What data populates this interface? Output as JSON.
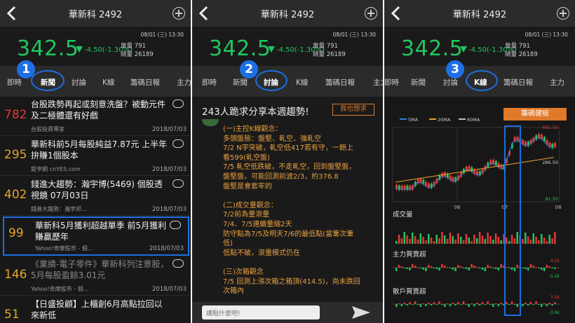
{
  "header": {
    "title": "華新科 2492"
  },
  "quote": {
    "time": "08/01 (三) 13:30",
    "price": "342.5",
    "change": "-4.50(-1.30%)",
    "single": "單量 791",
    "total": "總量 26189"
  },
  "tabs": [
    "即時",
    "新聞",
    "討論",
    "K線",
    "籌碼日報",
    "主力"
  ],
  "badges": [
    "1",
    "2",
    "3"
  ],
  "news": [
    {
      "num": "782",
      "color": "#e53935",
      "title": "台股跌勢再起或刻意洗盤？被動元件及二極體還有好戲",
      "source": "台股投資專家",
      "date": "2018/07/03",
      "dim": false
    },
    {
      "num": "295",
      "color": "#e6a52a",
      "title": "華新科前5月每股純益7.87元 上半年拚賺1個股本",
      "source": "鉅亨網 cnYES.com",
      "date": "2018/07/03",
      "dim": false
    },
    {
      "num": "402",
      "color": "#e6a52a",
      "title": "錢進大趨勢：瀚宇博(5469) 個股透視鏡 07月03日",
      "source": "錢進大趨勢：瀚宇邦...",
      "date": "2018/07/03",
      "dim": false
    },
    {
      "num": "99",
      "color": "#e6a52a",
      "title": "華新科5月獲利超越單季 前5月獲利賺贏歷年",
      "source": "Yahoo!奇摩股市 - 個...",
      "date": "2018/07/03",
      "dim": false
    },
    {
      "num": "146",
      "color": "#e6a52a",
      "title": "《業績-電子零件》華新科列注意股，5月每股盈餘3.01元",
      "source": "Yahoo!奇摩股市 - 個...",
      "date": "2018/07/03",
      "dim": true
    },
    {
      "num": "51",
      "color": "#e6a52a",
      "title": "【日盛投顧】上櫃創6月高點拉回以來新低",
      "source": "",
      "date": "",
      "dim": false
    }
  ],
  "discussion": {
    "headline": "243人跪求分享本週趨勢!",
    "button": "我也想求",
    "lines": [
      "(一)主控K線觀念：",
      "多頭盤態：盤堅、軋空、強軋空",
      "7/2 N字突破，軋空低417若有守，一飽上",
      "看599(軋空盤)",
      "7/5 軋空低跌破，不走軋空，回到盤堅盤，",
      "盤堅盤，可能回測前波2/3，約376.8",
      "盤堅是會套牢的",
      "",
      "(二)成交量觀念：",
      "7/2前為量滾量",
      "7/4、7/5連續量縮2天",
      "防守點為7/5及明天7/6的最低點(當筆次筆",
      "低)",
      "低點不破，滾量模式仍在",
      "",
      "(三)次箱觀念",
      "7/5 回測上漲次箱之箱頂(414.5)，尚未跌回",
      "次箱內"
    ],
    "placeholder": "講點什麼吧!"
  },
  "kline": {
    "button": "籌碼健檢",
    "legend": [
      "5MA",
      "20MA",
      "60MA"
    ],
    "legend_colors": [
      "#2e7dd7",
      "#e6a52a",
      "#c0c0c0"
    ],
    "high": "491.50",
    "mid": "286.50",
    "low": "81.50",
    "months": [
      "06",
      "07",
      "08"
    ],
    "volume": "成交量",
    "main": "主力買賣超",
    "retail": "散戶買賣超",
    "mainv": "4.5k",
    "mainv2": "-5.2k",
    "retailv": "3.5k",
    "retailv2": "-3.6k"
  }
}
